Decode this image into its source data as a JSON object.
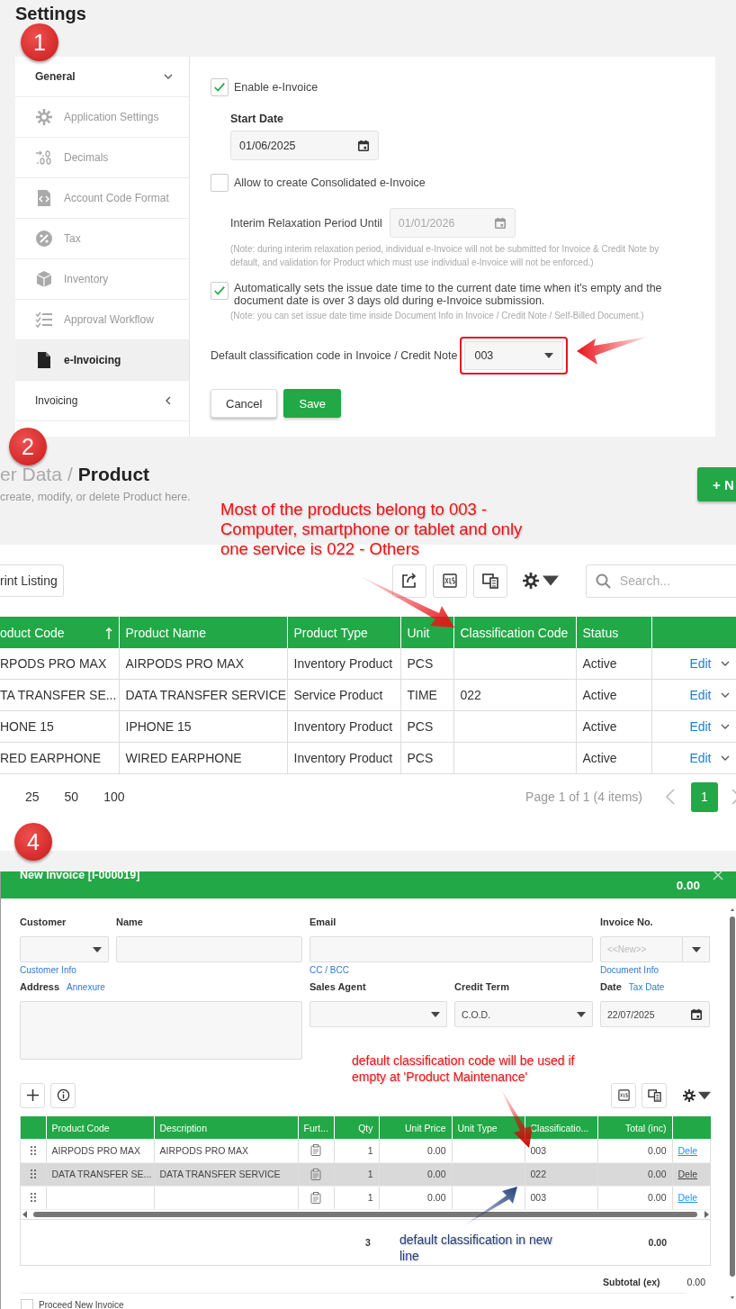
{
  "settings": {
    "title": "Settings",
    "step": "1",
    "sidebar": [
      {
        "label": "General",
        "kind": "group",
        "expanded": true
      },
      {
        "label": "Application Settings",
        "kind": "item",
        "selected": false
      },
      {
        "label": "Decimals",
        "kind": "item",
        "selected": false
      },
      {
        "label": "Account Code Format",
        "kind": "item",
        "selected": false
      },
      {
        "label": "Tax",
        "kind": "item",
        "selected": false
      },
      {
        "label": "Inventory",
        "kind": "item",
        "selected": false
      },
      {
        "label": "Approval Workflow",
        "kind": "item",
        "selected": false
      },
      {
        "label": "e-Invoicing",
        "kind": "item",
        "selected": true
      },
      {
        "label": "Invoicing",
        "kind": "group",
        "expanded": false
      }
    ],
    "enable": {
      "label": "Enable e-Invoice",
      "checked": true
    },
    "start_date": {
      "label": "Start Date",
      "value": "01/06/2025"
    },
    "consolidated": {
      "label": "Allow to create Consolidated e-Invoice",
      "checked": false
    },
    "interim": {
      "label": "Interim Relaxation Period Until",
      "value": "01/01/2026",
      "disabled": true
    },
    "interim_note": "(Note: during interim relaxation period, individual e-Invoice will not be submitted for Invoice & Credit Note by default, and validation for Product which must use individual e-Invoice will not be enforced.)",
    "auto_issue": {
      "label": "Automatically sets the issue date time to the current date time when it's empty and the document date is over 3 days old during e-Invoice submission.",
      "checked": true
    },
    "auto_note": "(Note: you can set issue date time inside Document Info in Invoice / Credit Note / Self-Billed Document.)",
    "default_code": {
      "label": "Default classification code in Invoice / Credit Note",
      "value": "003",
      "highlighted": true
    },
    "buttons": [
      {
        "label": "Cancel",
        "kind": "secondary"
      },
      {
        "label": "Save",
        "kind": "primary"
      }
    ]
  },
  "product": {
    "step": "2",
    "breadcrumb_parent": "er Data",
    "breadcrumb_separator": "/",
    "title": "Product",
    "subtitle": "create, modify, or delete Product here.",
    "new_button": "+ N",
    "annotation": "Most of the products belong to 003 - Computer, smartphone or tablet and only one service is 022 - Others",
    "print_button": "rint Listing",
    "search": {
      "placeholder": "Search..."
    },
    "columns": [
      {
        "label": "oduct Code",
        "sorted": true
      },
      {
        "label": "Product Name"
      },
      {
        "label": "Product Type"
      },
      {
        "label": "Unit"
      },
      {
        "label": "Classification Code"
      },
      {
        "label": "Status"
      }
    ],
    "rows": [
      {
        "code": "RPODS PRO MAX",
        "name": "AIRPODS PRO MAX",
        "type": "Inventory Product",
        "unit": "PCS",
        "classification": "",
        "status": "Active",
        "action": "Edit"
      },
      {
        "code": "TA TRANSFER SE...",
        "name": "DATA TRANSFER SERVICE",
        "type": "Service Product",
        "unit": "TIME",
        "classification": "022",
        "status": "Active",
        "action": "Edit"
      },
      {
        "code": "HONE 15",
        "name": "IPHONE 15",
        "type": "Inventory Product",
        "unit": "PCS",
        "classification": "",
        "status": "Active",
        "action": "Edit"
      },
      {
        "code": "RED EARPHONE",
        "name": "WIRED EARPHONE",
        "type": "Inventory Product",
        "unit": "PCS",
        "classification": "",
        "status": "Active",
        "action": "Edit"
      }
    ],
    "page_sizes": [
      "25",
      "50",
      "100"
    ],
    "page_info": "Page 1 of 1 (4 items)",
    "pages": [
      {
        "label": "1",
        "selected": true
      }
    ]
  },
  "invoice": {
    "step": "4",
    "title": "New Invoice [I-000019]",
    "total": "0.00",
    "customer": {
      "label": "Customer",
      "link": "Customer Info"
    },
    "name": {
      "label": "Name"
    },
    "email": {
      "label": "Email",
      "link": "CC / BCC"
    },
    "invoice_no": {
      "label": "Invoice No.",
      "placeholder": "<<New>>",
      "link": "Document Info"
    },
    "address": {
      "label": "Address",
      "link": "Annexure"
    },
    "sales_agent": {
      "label": "Sales Agent"
    },
    "credit_term": {
      "label": "Credit Term",
      "value": "C.O.D."
    },
    "date": {
      "label": "Date",
      "link": "Tax Date",
      "value": "22/07/2025"
    },
    "annotation_top": "default classification code will be used if empty at 'Product Maintenance'",
    "annotation_bottom": "default classification in new line",
    "columns": [
      "Product Code",
      "Description",
      "Furt...",
      "Qty",
      "Unit Price",
      "Unit Type",
      "Classificatio...",
      "Total (inc)"
    ],
    "rows": [
      {
        "code": "AIRPODS PRO MAX",
        "description": "AIRPODS PRO MAX",
        "qty": "1",
        "price": "0.00",
        "unit_type": "",
        "classification": "003",
        "total": "0.00",
        "action": "Dele",
        "selected": false
      },
      {
        "code": "DATA TRANSFER SE...",
        "description": "DATA TRANSFER SERVICE",
        "qty": "1",
        "price": "0.00",
        "unit_type": "",
        "classification": "022",
        "total": "0.00",
        "action": "Dele",
        "selected": true
      },
      {
        "code": "",
        "description": "",
        "qty": "1",
        "price": "0.00",
        "unit_type": "",
        "classification": "003",
        "total": "0.00",
        "action": "Dele",
        "selected": false
      }
    ],
    "total_qty": "3",
    "total_amount": "0.00",
    "subtotal_label": "Subtotal (ex)",
    "subtotal": "0.00",
    "proceed": {
      "label": "Proceed New Invoice",
      "checked": false
    }
  }
}
